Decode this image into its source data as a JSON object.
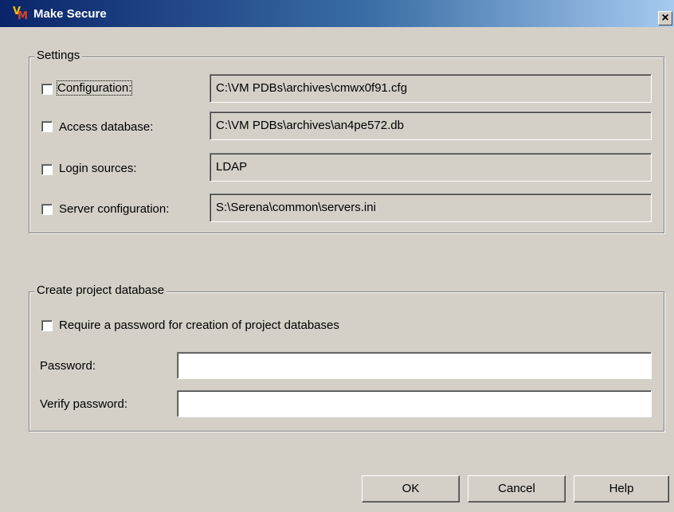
{
  "window": {
    "title": "Make Secure",
    "close_symbol": "×"
  },
  "settings": {
    "legend": "Settings",
    "rows": [
      {
        "label": "Configuration:",
        "value": "C:\\VM PDBs\\archives\\cmwx0f91.cfg"
      },
      {
        "label": "Access database:",
        "value": "C:\\VM PDBs\\archives\\an4pe572.db"
      },
      {
        "label": "Login sources:",
        "value": "LDAP"
      },
      {
        "label": "Server configuration:",
        "value": "S:\\Serena\\common\\servers.ini"
      }
    ]
  },
  "create_project_database": {
    "legend": "Create project database",
    "require_password_label": "Require a password for creation of project databases",
    "password_label": "Password:",
    "password_value": "",
    "verify_label": "Verify password:",
    "verify_value": ""
  },
  "buttons": {
    "ok": "OK",
    "cancel": "Cancel",
    "help": "Help"
  }
}
